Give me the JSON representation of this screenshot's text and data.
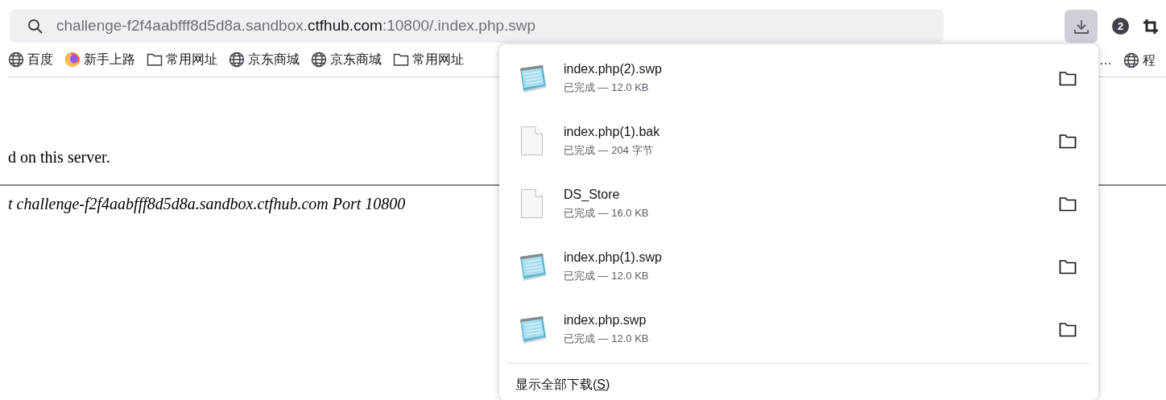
{
  "address_bar": {
    "url_parts": [
      {
        "text": "challenge-f2f4aabfff8d5d8a.sandbox.",
        "emphasized": false
      },
      {
        "text": "ctfhub.com",
        "emphasized": true
      },
      {
        "text": ":10800/.index.php.swp",
        "emphasized": false
      }
    ]
  },
  "toolbar": {
    "downloads_active": true,
    "badge": "2"
  },
  "bookmarks": [
    {
      "kind": "globe",
      "label": "百度"
    },
    {
      "kind": "firefox",
      "label": "新手上路"
    },
    {
      "kind": "folder",
      "label": "常用网址"
    },
    {
      "kind": "globe",
      "label": "京东商城"
    },
    {
      "kind": "globe",
      "label": "京东商城"
    },
    {
      "kind": "folder",
      "label": "常用网址"
    }
  ],
  "bookmarks_right": [
    {
      "kind": "none",
      "label": "…"
    },
    {
      "kind": "globe",
      "label": "程"
    }
  ],
  "page": {
    "message": "d on this server.",
    "footer": "t challenge-f2f4aabfff8d5d8a.sandbox.ctfhub.com Port 10800"
  },
  "downloads": [
    {
      "kind": "notepad",
      "name": "index.php(2).swp",
      "status": "已完成 — 12.0 KB"
    },
    {
      "kind": "blank",
      "name": "index.php(1).bak",
      "status": "已完成 — 204 字节"
    },
    {
      "kind": "blank",
      "name": "DS_Store",
      "status": "已完成 — 16.0 KB"
    },
    {
      "kind": "notepad",
      "name": "index.php(1).swp",
      "status": "已完成 — 12.0 KB"
    },
    {
      "kind": "notepad",
      "name": "index.php.swp",
      "status": "已完成 — 12.0 KB"
    }
  ],
  "show_all": {
    "label_before": "显示全部下载(",
    "access_key": "S",
    "label_after": ")"
  }
}
